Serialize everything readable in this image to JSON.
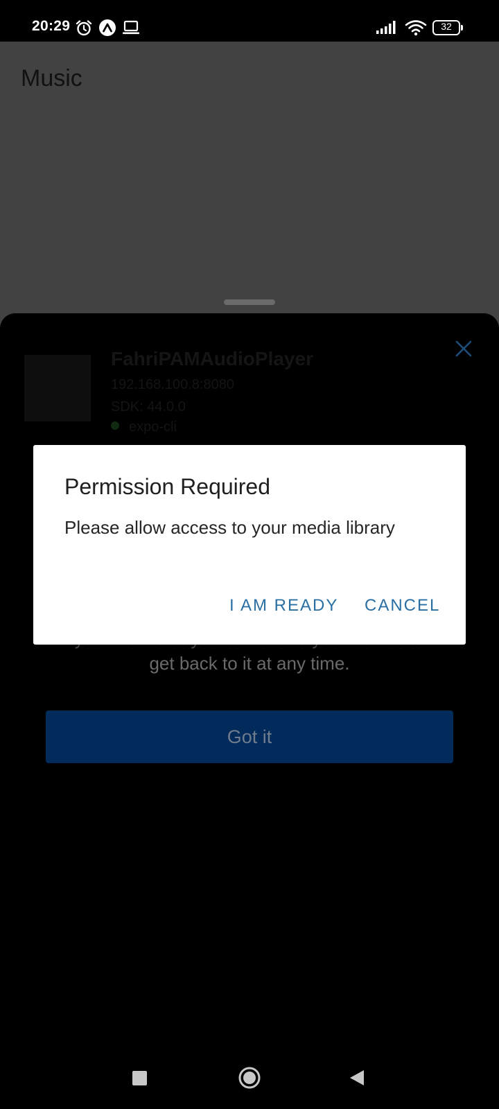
{
  "status_bar": {
    "time": "20:29",
    "battery_level": "32",
    "icons": [
      "alarm-icon",
      "expo-icon",
      "laptop-icon",
      "signal-icon",
      "wifi-icon",
      "battery-icon"
    ]
  },
  "app": {
    "title": "Music"
  },
  "sheet": {
    "app_name": "FahriPAMAudioPlayer",
    "url": "192.168.100.8:8080",
    "sdk": "SDK: 44.0.0",
    "cli_label": "expo-cli",
    "message_line1": "you know that you can shake your device to",
    "message_line2": "get back to it at any time.",
    "got_it_label": "Got it"
  },
  "dialog": {
    "title": "Permission Required",
    "message": "Please allow access to your media library",
    "ready_label": "I AM READY",
    "cancel_label": "CANCEL"
  },
  "colors": {
    "dialog_button": "#2a6fa4",
    "sheet_close": "#1d4e7a",
    "got_it_button": "#022b5c",
    "dim_background": "#424242"
  }
}
